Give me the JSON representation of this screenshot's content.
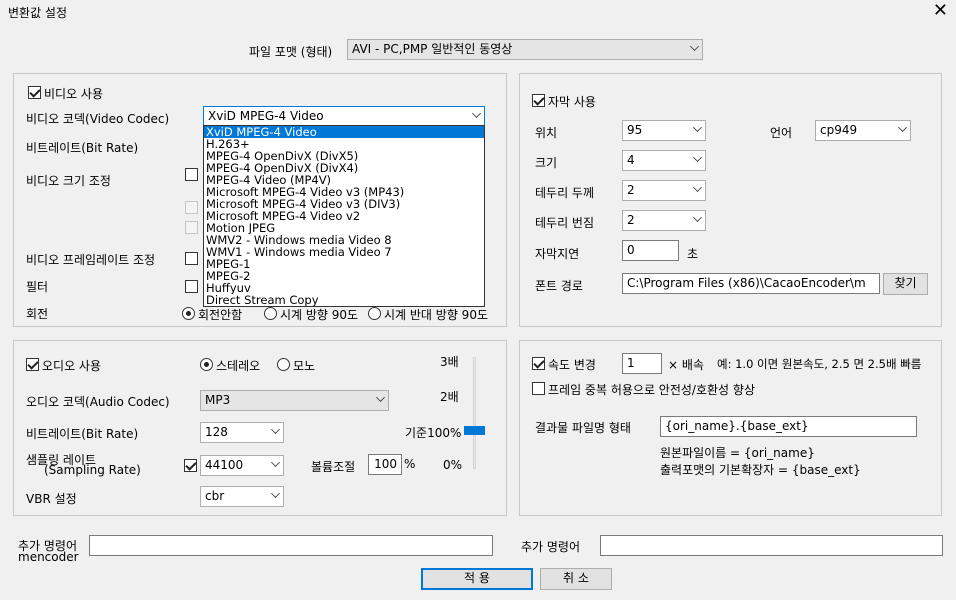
{
  "window": {
    "title": "변환값 설정"
  },
  "file_format": {
    "label": "파일 포맷 (형태)",
    "value": "AVI - PC,PMP 일반적인 동영상"
  },
  "video": {
    "enable_label": "비디오 사용",
    "codec_label": "비디오 코덱(Video Codec)",
    "codec_value": "XviD MPEG-4 Video",
    "codec_options": [
      "XviD MPEG-4 Video",
      "H.263+",
      "MPEG-4 OpenDivX (DivX5)",
      "MPEG-4 OpenDivX (DivX4)",
      "MPEG-4 Video (MP4V)",
      "Microsoft MPEG-4 Video v3 (MP43)",
      "Microsoft MPEG-4 Video v3 (DIV3)",
      "Microsoft MPEG-4 Video v2",
      "Motion JPEG",
      "WMV2 - Windows media Video 8",
      "WMV1 - Windows media Video 7",
      "MPEG-1",
      "MPEG-2",
      "Huffyuv",
      "Direct Stream Copy"
    ],
    "bitrate_label": "비트레이트(Bit Rate)",
    "size_label": "비디오 크기 조정",
    "framerate_label": "비디오 프레임레이트 조정",
    "filter_label": "필터",
    "rotation_label": "회전",
    "rotation_options": [
      "회전안함",
      "시계 방향 90도",
      "시계 반대 방향 90도"
    ]
  },
  "audio": {
    "enable_label": "오디오 사용",
    "stereo_label": "스테레오",
    "mono_label": "모노",
    "codec_label": "오디오 코덱(Audio Codec)",
    "codec_value": "MP3",
    "bitrate_label": "비트레이트(Bit Rate)",
    "bitrate_value": "128",
    "sampling_label_1": "샘플링 레이트",
    "sampling_label_2": "(Sampling Rate)",
    "sampling_value": "44100",
    "vbr_label": "VBR 설정",
    "vbr_value": "cbr",
    "volume_label": "볼륨조절",
    "volume_value": "100",
    "volume_unit": "%",
    "scale_3x": "3배",
    "scale_2x": "2배",
    "scale_base": "기준100%",
    "scale_0": "0%",
    "slider_level": 0.33
  },
  "subtitle": {
    "enable_label": "자막 사용",
    "position_label": "위치",
    "position_value": "95",
    "language_label": "언어",
    "language_value": "cp949",
    "size_label": "크기",
    "size_value": "4",
    "border_width_label": "테두리 두께",
    "border_width_value": "2",
    "border_blur_label": "테두리 번짐",
    "border_blur_value": "2",
    "delay_label": "자막지연",
    "delay_value": "0",
    "delay_unit": "초",
    "font_path_label": "폰트 경로",
    "font_path_value": "C:\\Program Files (x86)\\CacaoEncoder\\m",
    "browse_label": "찾기"
  },
  "speed": {
    "enable_label": "속도 변경",
    "multiplier_value": "1",
    "multiplier_unit": "× 배속",
    "example": "예: 1.0 이면 원본속도, 2.5 면 2.5배 빠름",
    "frame_dup_label": "프레임 중복 허용으로 안전성/호환성 향상",
    "output_name_label": "결과물 파일명 형태",
    "output_name_value": "{ori_name}.{base_ext}",
    "hint_1": "원본파일이름 = {ori_name}",
    "hint_2": "출력포맷의 기본확장자 = {base_ext}"
  },
  "extra": {
    "mencoder_label_1": "추가 명령어",
    "mencoder_label_2": "mencoder",
    "mencoder_value": "",
    "cmd_label": "추가 명령어",
    "cmd_value": ""
  },
  "buttons": {
    "apply": "적 용",
    "cancel": "취 소"
  }
}
